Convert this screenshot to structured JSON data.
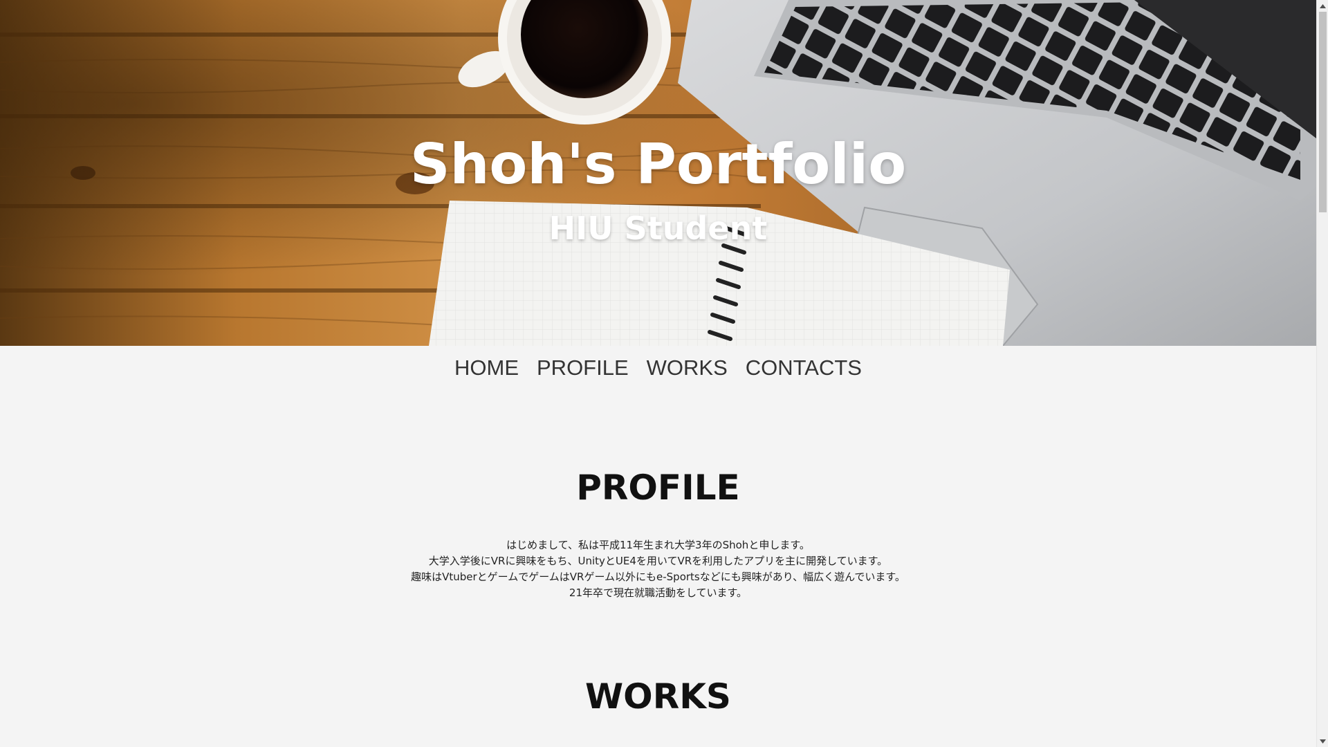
{
  "hero": {
    "title": "Shoh's Portfolio",
    "subtitle": "HIU Student"
  },
  "nav": {
    "items": [
      {
        "label": "HOME"
      },
      {
        "label": "PROFILE"
      },
      {
        "label": "WORKS"
      },
      {
        "label": "CONTACTS"
      }
    ]
  },
  "profile": {
    "heading": "PROFILE",
    "lines": [
      "はじめまして、私は平成11年生まれ大学3年のShohと申します。",
      "大学入学後にVRに興味をもち、UnityとUE4を用いてVRを利用したアプリを主に開発しています。",
      "趣味はVtuberとゲームでゲームはVRゲーム以外にもe-Sportsなどにも興味があり、幅広く遊んでいます。",
      "21年卒で現在就職活動をしています。"
    ]
  },
  "works": {
    "heading": "WORKS"
  },
  "colors": {
    "page_background": "#f4f4f4",
    "hero_text": "#ffffff",
    "nav_text": "#333333",
    "heading_text": "#111111"
  }
}
